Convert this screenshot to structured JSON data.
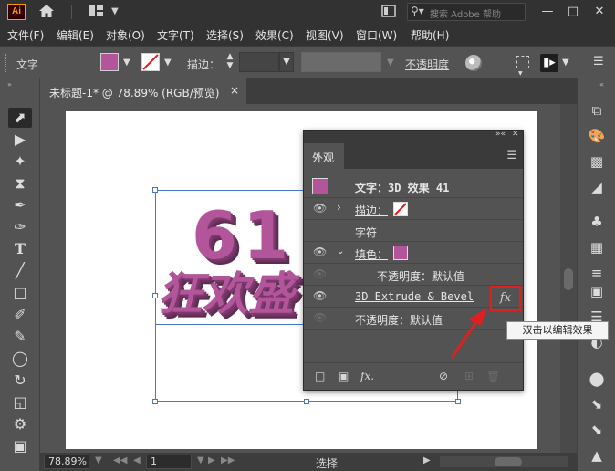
{
  "app": {
    "logo": "Ai",
    "search_placeholder": "搜索 Adobe 帮助"
  },
  "menu": [
    "文件(F)",
    "编辑(E)",
    "对象(O)",
    "文字(T)",
    "选择(S)",
    "效果(C)",
    "视图(V)",
    "窗口(W)",
    "帮助(H)"
  ],
  "control": {
    "object_type": "文字",
    "stroke_label": "描边：",
    "opacity_label": "不透明度"
  },
  "document": {
    "tab_title": "未标题-1* @ 78.89% (RGB/预览)",
    "close": "×"
  },
  "artwork": {
    "line1": "61",
    "line2": "狂欢盛"
  },
  "status": {
    "zoom": "78.89%",
    "page": "1",
    "tool_mode": "选择"
  },
  "appearance": {
    "tab": "外观",
    "title_row": "文字：3D 效果 41",
    "stroke": "描边：",
    "characters": "字符",
    "fill": "填色：",
    "fill_opacity": "不透明度：默认值",
    "effect": "3D Extrude & Bevel",
    "opacity": "不透明度：默认值",
    "fx_label": "fx",
    "tooltip": "双击以编辑效果"
  },
  "colors": {
    "fill": "#b2559a",
    "highlight": "#e02020",
    "selection": "#4a78c9"
  },
  "icons": [
    "home-icon",
    "workspace-icon",
    "search-icon",
    "eye-icon",
    "chevron-right-icon",
    "chevron-down-icon",
    "fx-icon",
    "new-stroke-icon",
    "new-fill-icon",
    "clear-icon",
    "duplicate-icon",
    "trash-icon"
  ]
}
